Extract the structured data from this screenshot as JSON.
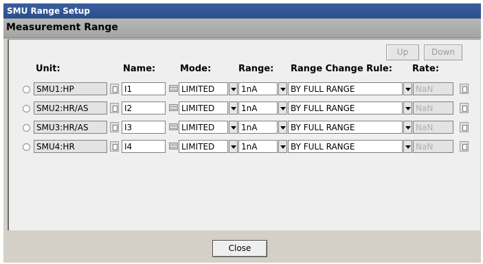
{
  "window": {
    "title": "SMU Range Setup"
  },
  "section": {
    "title": "Measurement Range"
  },
  "toolbar": {
    "up_label": "Up",
    "down_label": "Down"
  },
  "columns": {
    "unit": "Unit:",
    "name": "Name:",
    "mode": "Mode:",
    "range": "Range:",
    "rule": "Range Change Rule:",
    "rate": "Rate:"
  },
  "rows": [
    {
      "unit": "SMU1:HP",
      "name": "I1",
      "mode": "LIMITED",
      "range": "1nA",
      "rule": "BY FULL RANGE",
      "rate": "NaN"
    },
    {
      "unit": "SMU2:HR/AS",
      "name": "I2",
      "mode": "LIMITED",
      "range": "1nA",
      "rule": "BY FULL RANGE",
      "rate": "NaN"
    },
    {
      "unit": "SMU3:HR/AS",
      "name": "I3",
      "mode": "LIMITED",
      "range": "1nA",
      "rule": "BY FULL RANGE",
      "rate": "NaN"
    },
    {
      "unit": "SMU4:HR",
      "name": "I4",
      "mode": "LIMITED",
      "range": "1nA",
      "rule": "BY FULL RANGE",
      "rate": "NaN"
    }
  ],
  "footer": {
    "close_label": "Close"
  },
  "icons": {
    "unit_picker": "calculator-icon",
    "name_keyboard": "keyboard-icon",
    "rate_calc": "calculator-icon",
    "dropdown": "chevron-down-icon",
    "select": "radio-icon"
  },
  "colors": {
    "title_bar": "#2b4f8f",
    "section_bar": "#a9a9a9",
    "dialog_bg": "#d4d0c8",
    "panel_bg": "#efefef"
  }
}
